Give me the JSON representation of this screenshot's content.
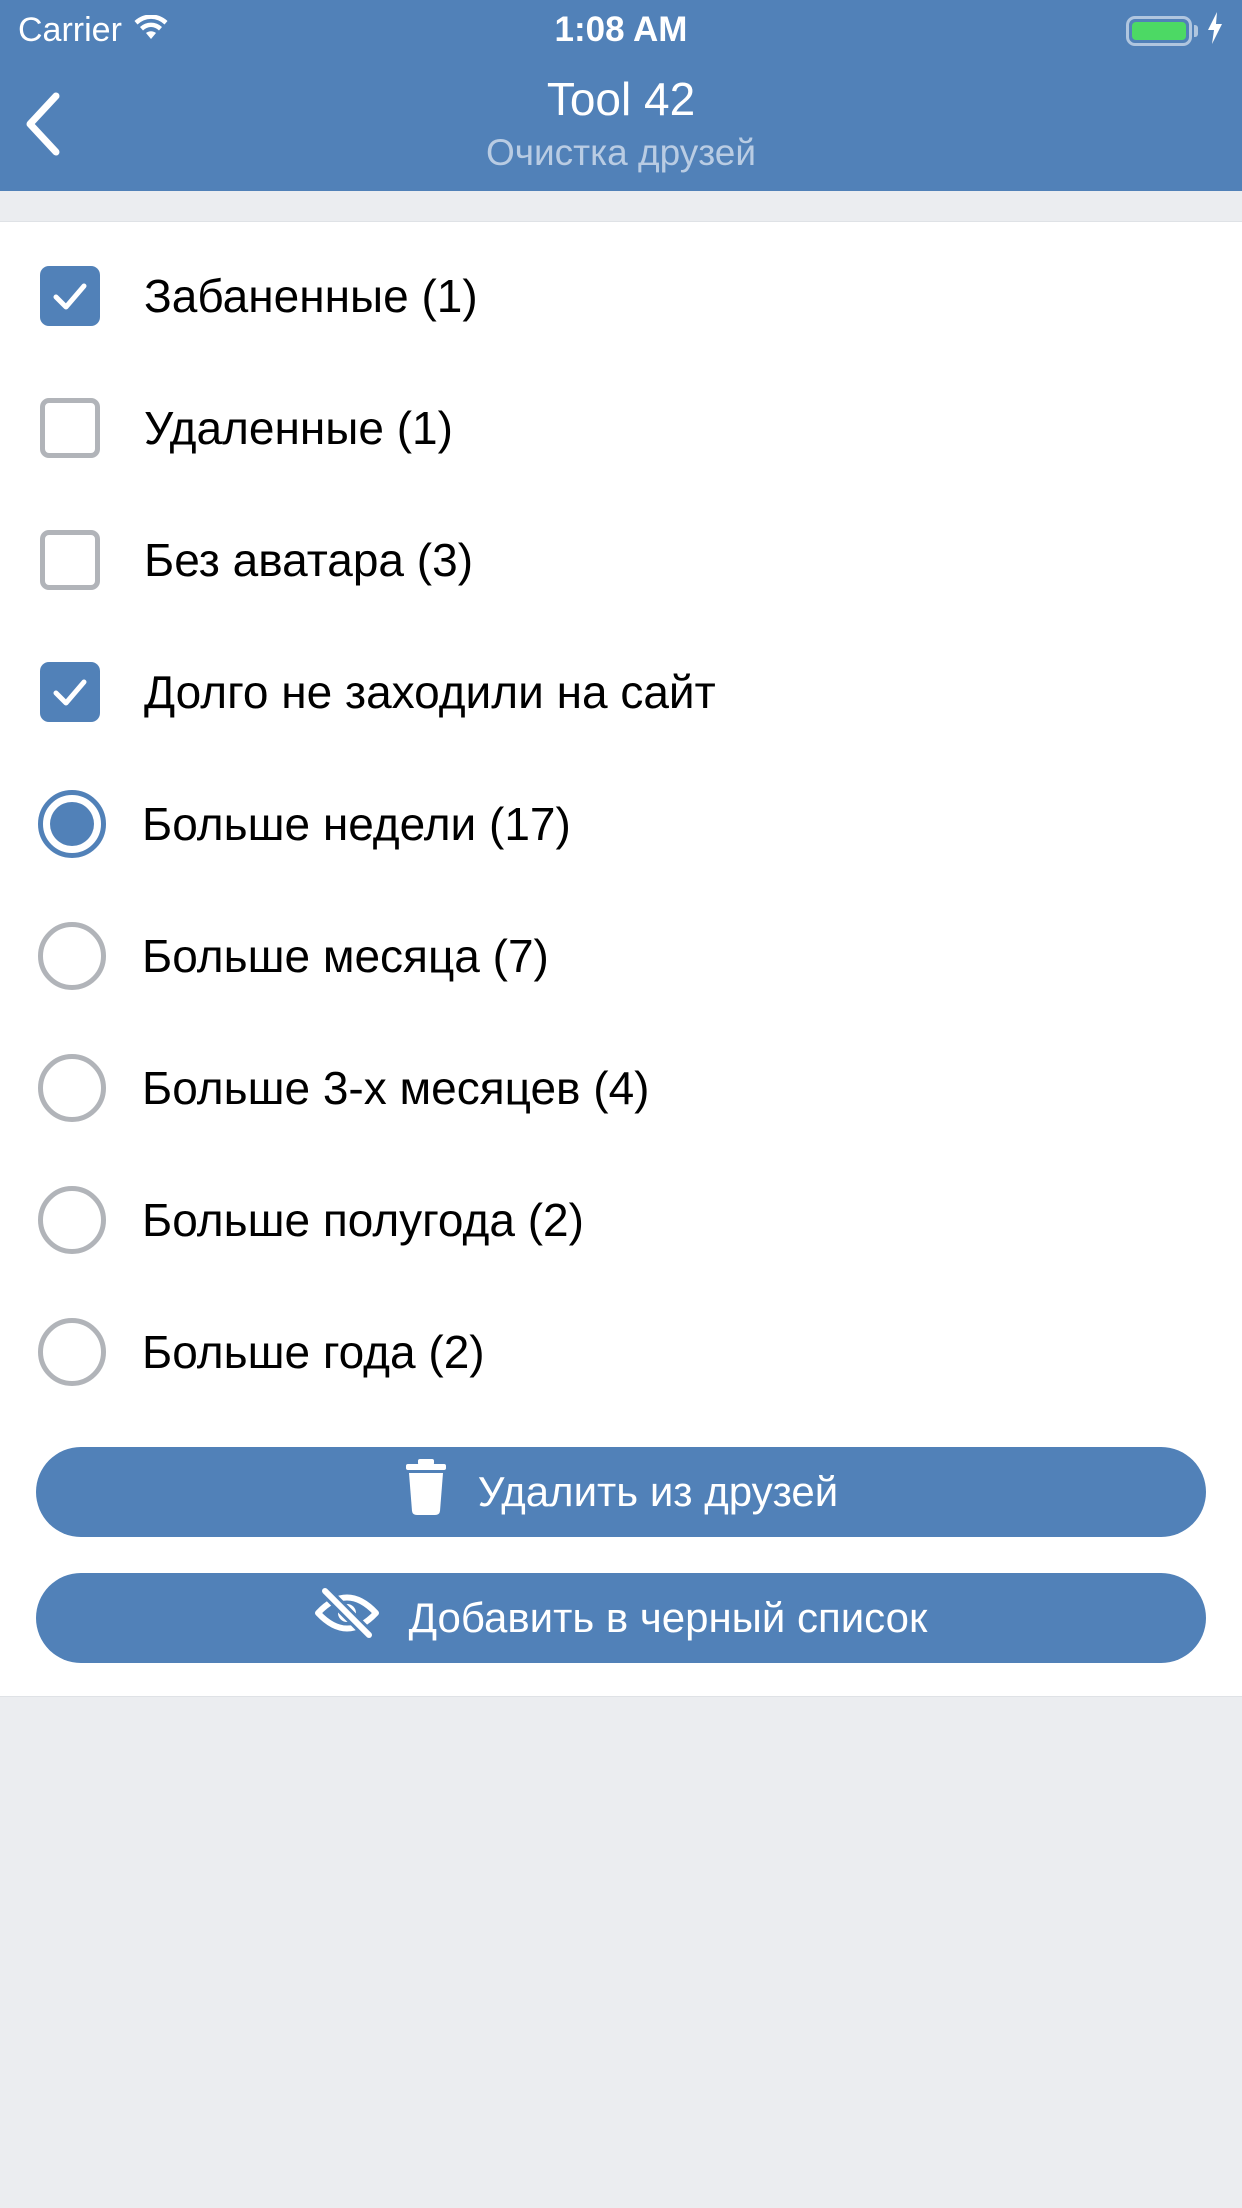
{
  "status_bar": {
    "carrier": "Carrier",
    "time": "1:08 AM",
    "icons": [
      "wifi-icon",
      "battery-icon",
      "charging-bolt-icon"
    ],
    "battery_color": "#4cd964"
  },
  "nav": {
    "back_icon": "chevron-left-icon",
    "title": "Tool 42",
    "subtitle": "Очистка друзей",
    "bar_color": "#5181b8"
  },
  "filters": {
    "banned": {
      "label": "Забаненные (1)",
      "checked": true
    },
    "deleted": {
      "label": "Удаленные (1)",
      "checked": false
    },
    "no_avatar": {
      "label": "Без аватара (3)",
      "checked": false
    },
    "inactive": {
      "label": "Долго не заходили на сайт",
      "checked": true
    }
  },
  "inactive_period": {
    "selected_index": 0,
    "options": [
      {
        "label": "Больше недели (17)"
      },
      {
        "label": "Больше месяца (7)"
      },
      {
        "label": "Больше 3-х месяцев (4)"
      },
      {
        "label": "Больше полугода (2)"
      },
      {
        "label": "Больше года (2)"
      }
    ]
  },
  "actions": {
    "remove": {
      "label": "Удалить из друзей",
      "icon": "trash-icon"
    },
    "blacklist": {
      "label": "Добавить в черный список",
      "icon": "eye-slash-icon"
    }
  },
  "accent_color": "#5181b8"
}
